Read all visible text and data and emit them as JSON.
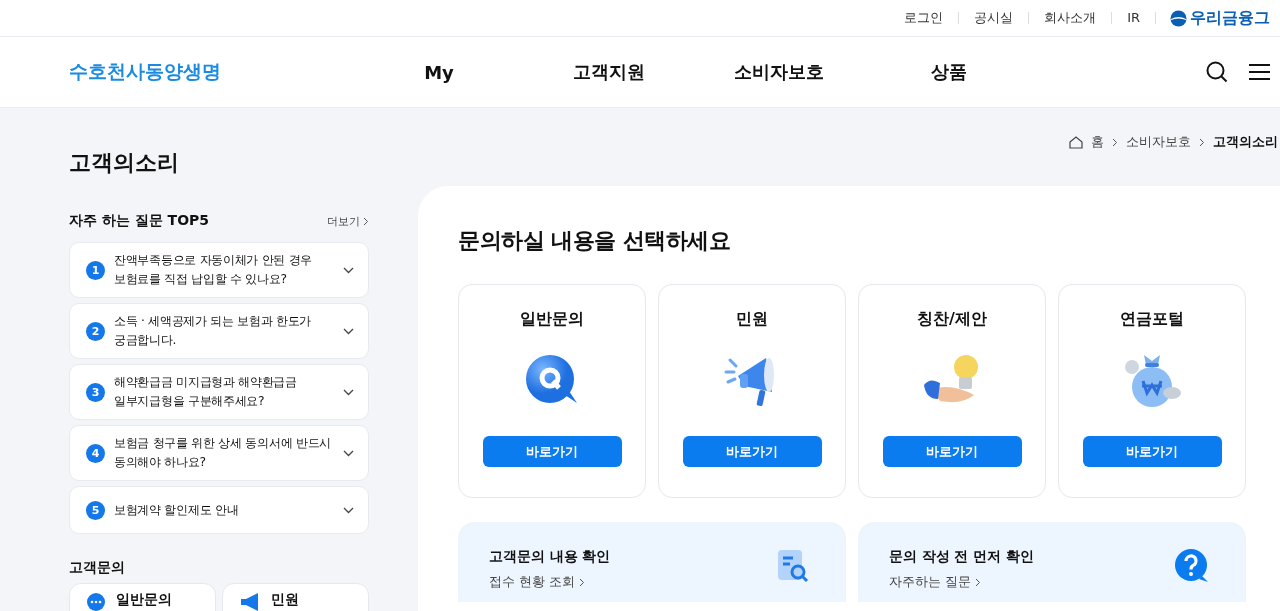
{
  "utility_links": [
    "로그인",
    "공시실",
    "회사소개",
    "IR"
  ],
  "group_logo": "우리금융그",
  "header": {
    "logo": "수호천사동양생명",
    "nav": [
      "My",
      "고객지원",
      "소비자보호",
      "상품"
    ]
  },
  "page_title": "고객의소리",
  "breadcrumb": [
    "홈",
    "소비자보호",
    "고객의소리"
  ],
  "faq": {
    "title": "자주 하는 질문 TOP5",
    "more": "더보기",
    "items": [
      {
        "number": "1",
        "text": "잔액부족등으로 자동이체가 안된 경우\n보험료를 직접 납입할 수 있나요?",
        "expanded": false
      },
      {
        "number": "2",
        "text": "소득 · 세액공제가 되는 보험과 한도가\n궁금합니다.",
        "expanded": false
      },
      {
        "number": "3",
        "text": "해약환급금 미지급형과 해약환급금\n일부지급형을 구분해주세요?",
        "expanded": false
      },
      {
        "number": "4",
        "text": "보험금 청구를 위한 상세 동의서에 반드시\n동의해야 하나요?",
        "expanded": false
      },
      {
        "number": "5",
        "text": "보험계약 할인제도 안내",
        "expanded": false
      }
    ]
  },
  "inquiry": {
    "title": "고객문의",
    "items": [
      {
        "label": "일반문의",
        "kind": "chat"
      },
      {
        "label": "민원",
        "kind": "megaphone"
      }
    ]
  },
  "main": {
    "title": "문의하실 내용을 선택하세요",
    "categories": [
      {
        "title": "일반문의",
        "kind": "question",
        "button": "바로가기"
      },
      {
        "title": "민원",
        "kind": "megaphone",
        "button": "바로가기"
      },
      {
        "title": "칭찬/제안",
        "kind": "bulb",
        "button": "바로가기"
      },
      {
        "title": "연금포털",
        "kind": "moneybag",
        "button": "바로가기"
      }
    ],
    "shortcuts": [
      {
        "title": "고객문의 내용 확인",
        "link": "접수 현황 조회",
        "kind": "search"
      },
      {
        "title": "문의 작성 전 먼저 확인",
        "link": "자주하는 질문",
        "kind": "help"
      }
    ]
  }
}
